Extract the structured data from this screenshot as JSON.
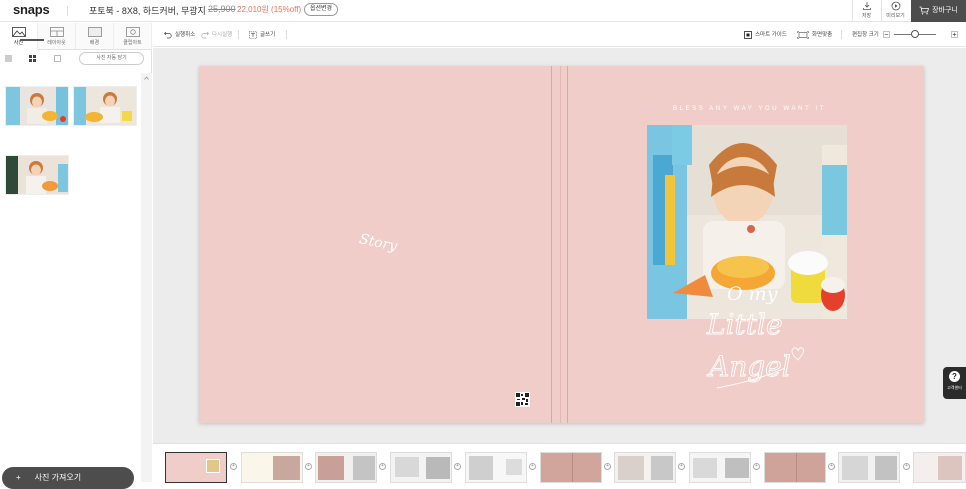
{
  "header": {
    "logo": "snaps",
    "product_title": "포토북 - 8X8, 하드커버, 무광지",
    "price_old": "25,900",
    "price_new": "22,010원 (15%off)",
    "option_button": "옵션변경",
    "save_label": "저장",
    "preview_label": "미리보기",
    "cart_label": "장바구니"
  },
  "left_panel": {
    "tabs": [
      {
        "label": "사진",
        "icon": "photo-icon"
      },
      {
        "label": "레이아웃",
        "icon": "layout-icon"
      },
      {
        "label": "배경",
        "icon": "background-icon"
      },
      {
        "label": "클립아트",
        "icon": "clipart-icon"
      }
    ],
    "hide_used_label": "사진 자동 담기",
    "upload_label": "사진 가져오기"
  },
  "toolbar": {
    "undo": "실행취소",
    "redo": "다시실행",
    "text": "글쓰기",
    "smart_guide": "스마트 가이드",
    "fit_screen": "화면맞춤",
    "edit_size": "편집창 크기",
    "zoom_level": 0.5
  },
  "spread": {
    "left_text": "Story",
    "right_caption": "BLESS ANY WAY YOU WANT IT",
    "script_lines": [
      "O my",
      "Little",
      "Angel"
    ],
    "background_color": "#f0cdc8"
  },
  "help": {
    "label": "고객센터"
  },
  "filmstrip": {
    "page_count": 11,
    "selected_index": 0
  }
}
